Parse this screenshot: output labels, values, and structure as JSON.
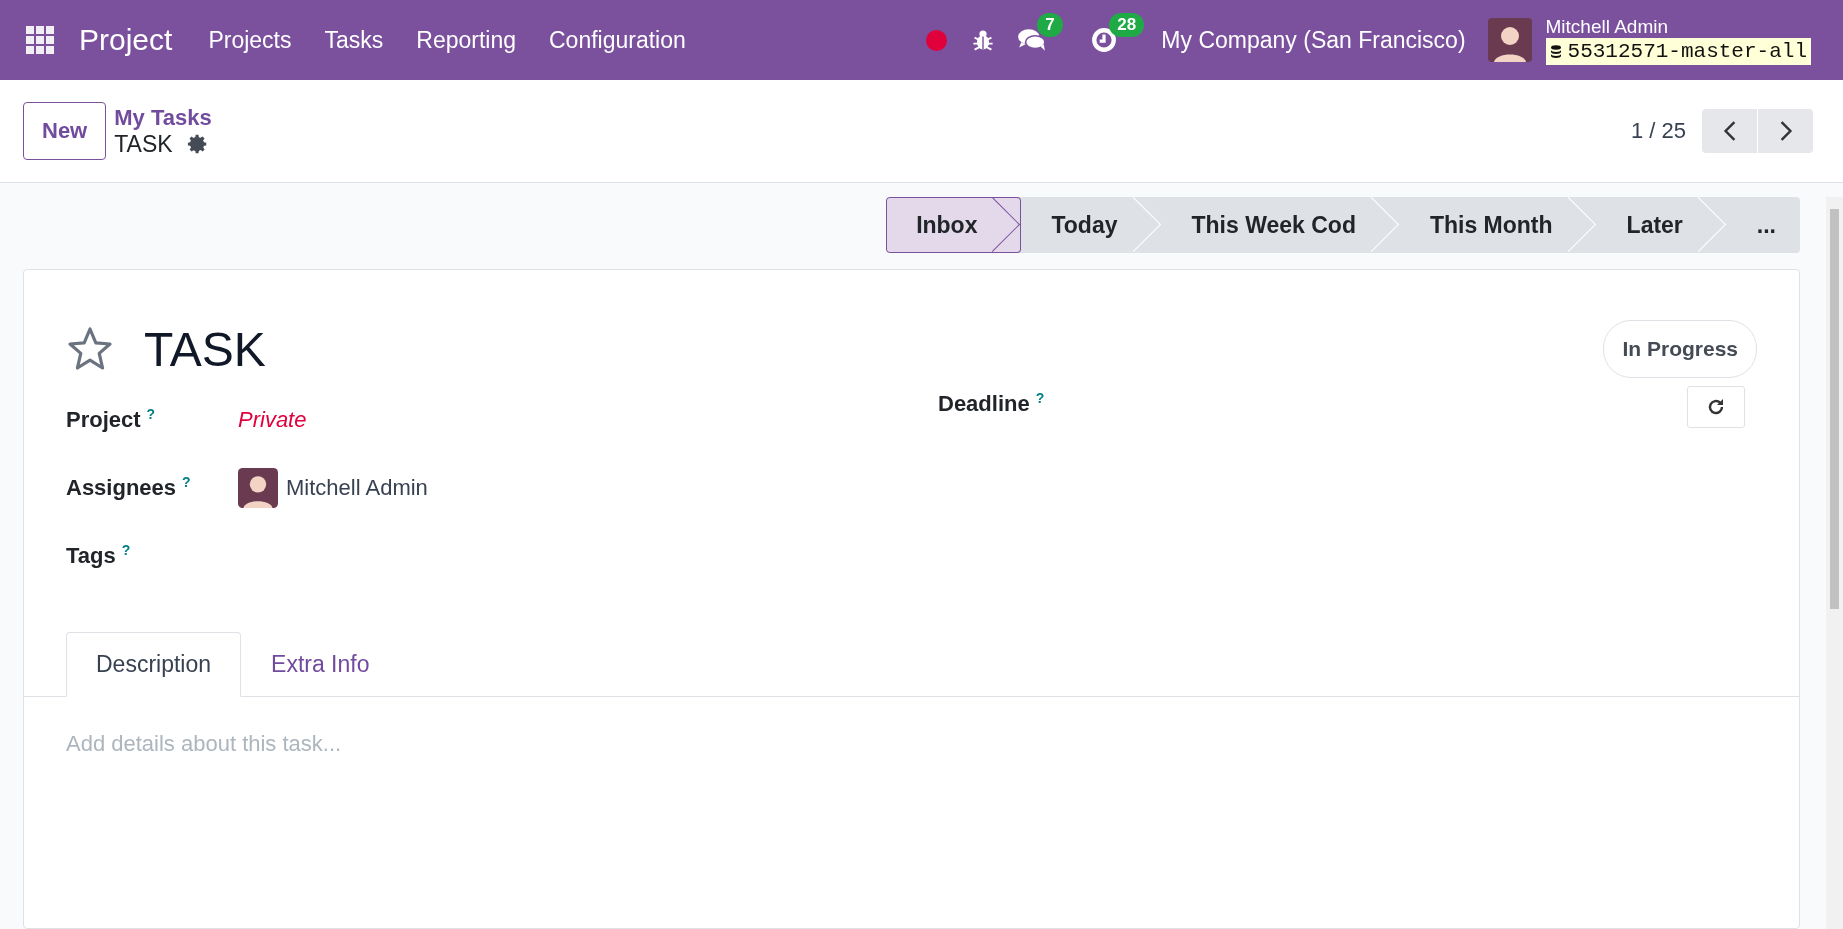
{
  "navbar": {
    "app_name": "Project",
    "menu": [
      "Projects",
      "Tasks",
      "Reporting",
      "Configuration"
    ],
    "messages_count": "7",
    "activities_count": "28",
    "company": "My Company (San Francisco)",
    "user": "Mitchell Admin",
    "database": "55312571-master-all"
  },
  "control_panel": {
    "new_button": "New",
    "breadcrumb": "My Tasks",
    "record": "TASK",
    "pager": "1 / 25"
  },
  "stages": [
    {
      "label": "Inbox",
      "selected": true
    },
    {
      "label": "Today",
      "selected": false
    },
    {
      "label": "This Week Cod",
      "selected": false
    },
    {
      "label": "This Month",
      "selected": false
    },
    {
      "label": "Later",
      "selected": false
    },
    {
      "label": "...",
      "selected": false
    }
  ],
  "form": {
    "starred": false,
    "title": "TASK",
    "state": "In Progress",
    "fields": [
      {
        "label": "Project",
        "help": "?",
        "kind": "link",
        "value": "Private"
      },
      {
        "label": "Assignees",
        "help": "?",
        "kind": "user",
        "value": "Mitchell Admin"
      },
      {
        "label": "Tags",
        "help": "?",
        "kind": "empty"
      }
    ],
    "deadline": {
      "label": "Deadline",
      "help": "?"
    }
  },
  "tabs": [
    {
      "label": "Description",
      "selected": true
    },
    {
      "label": "Extra Info",
      "selected": false
    }
  ],
  "description": {
    "placeholder": "Add details about this task..."
  }
}
